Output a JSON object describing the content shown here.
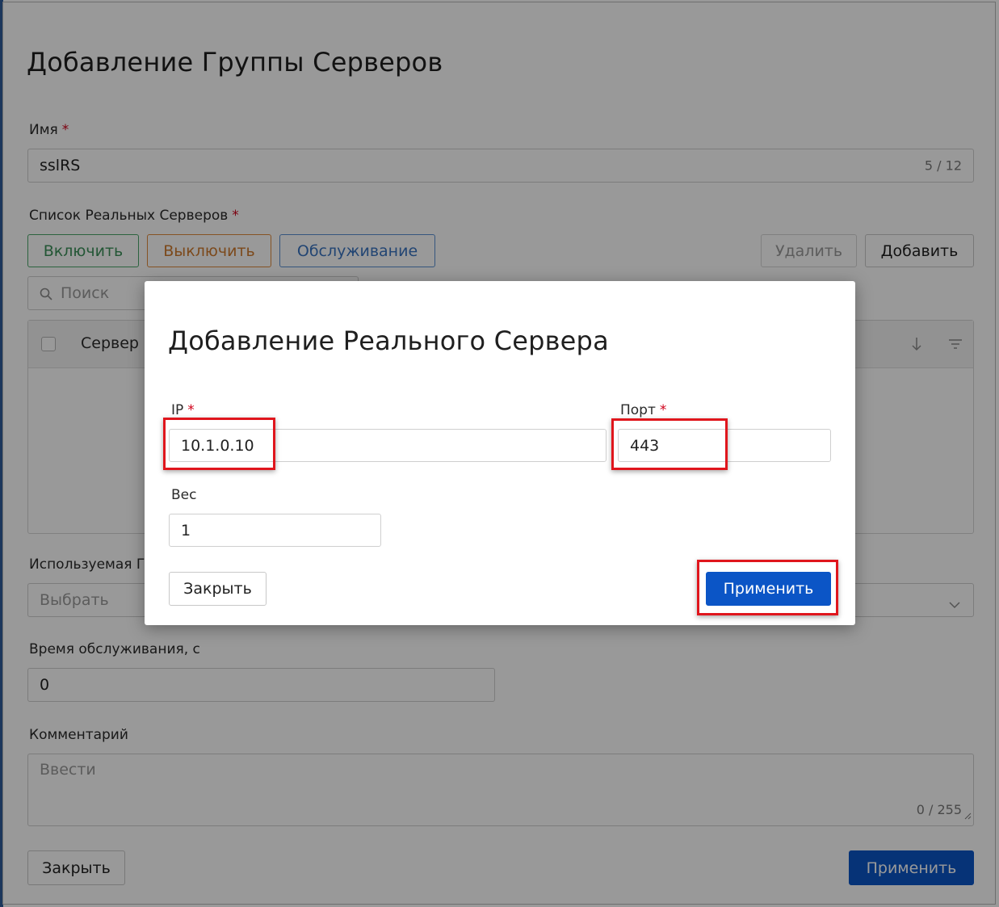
{
  "background_form": {
    "title": "Добавление Группы Серверов",
    "name_label": "Имя",
    "name_value": "sslRS",
    "name_counter": "5 / 12",
    "servers_label": "Список Реальных Серверов",
    "btn_enable": "Включить",
    "btn_disable": "Выключить",
    "btn_maintenance": "Обслуживание",
    "btn_delete": "Удалить",
    "btn_add": "Добавить",
    "search_placeholder": "Поиск",
    "table_col_server": "Сервер",
    "used_label": "Используемая Г",
    "select_placeholder": "Выбрать",
    "maint_label": "Время обслуживания, с",
    "maint_value": "0",
    "comment_label": "Комментарий",
    "comment_placeholder": "Ввести",
    "comment_counter": "0 / 255",
    "btn_close": "Закрыть",
    "btn_apply": "Применить"
  },
  "modal": {
    "title": "Добавление Реального Сервера",
    "ip_label": "IP",
    "ip_value": "10.1.0.10",
    "port_label": "Порт",
    "port_value": "443",
    "weight_label": "Вес",
    "weight_value": "1",
    "btn_close": "Закрыть",
    "btn_apply": "Применить"
  },
  "required_mark": "*",
  "colors": {
    "primary": "#0b55c6",
    "highlight": "#e0161d",
    "required": "#d0021b"
  }
}
